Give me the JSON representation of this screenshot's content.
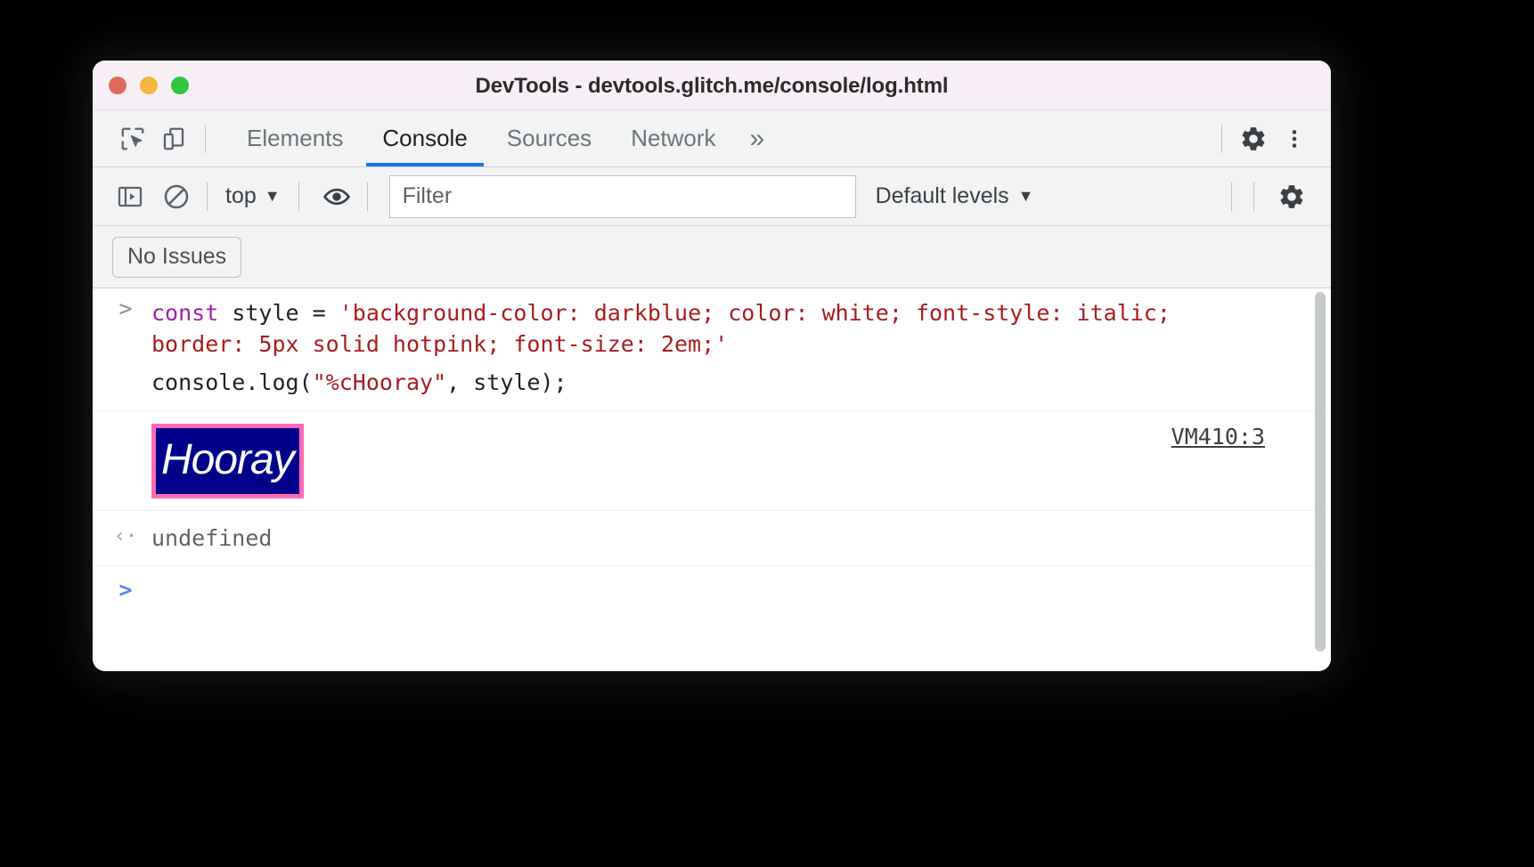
{
  "window": {
    "title": "DevTools - devtools.glitch.me/console/log.html",
    "traffic_lights": [
      {
        "name": "close",
        "color": "#e0695f"
      },
      {
        "name": "minimize",
        "color": "#f4b63f"
      },
      {
        "name": "maximize",
        "color": "#2ec840"
      }
    ]
  },
  "tabbar": {
    "left_icons": [
      {
        "name": "inspect-element-icon",
        "label": "Inspect element"
      },
      {
        "name": "device-toolbar-icon",
        "label": "Toggle device toolbar"
      }
    ],
    "tabs": [
      {
        "label": "Elements",
        "active": false
      },
      {
        "label": "Console",
        "active": true
      },
      {
        "label": "Sources",
        "active": false
      },
      {
        "label": "Network",
        "active": false
      }
    ],
    "more_tabs_label": "»",
    "right_icons": [
      {
        "name": "settings-gear-icon",
        "label": "Settings"
      },
      {
        "name": "more-options-icon",
        "label": "Customize and control DevTools"
      }
    ],
    "active_underline_color": "#1a73e8"
  },
  "filterbar": {
    "sidebar_toggle": "console-sidebar-icon",
    "clear_console": "clear-console-icon",
    "context_selector": {
      "value": "top",
      "caret": "▼"
    },
    "live_expression": "eye-icon",
    "filter": {
      "placeholder": "Filter",
      "value": ""
    },
    "levels_selector": {
      "value": "Default levels",
      "caret": "▼"
    },
    "settings_gear": "console-settings-gear-icon"
  },
  "issuesbar": {
    "no_issues_label": "No Issues"
  },
  "console": {
    "input_prompt": ">",
    "input_line": {
      "keyword": "const",
      "middle": " style = ",
      "string": "'background-color: darkblue; color: white; font-style: italic; border: 5px solid hotpink; font-size: 2em;'"
    },
    "log_line": {
      "before": "console.log(",
      "string": "\"%cHooray\"",
      "after": ", style);"
    },
    "output": {
      "text": "Hooray",
      "background_color": "#00008b",
      "text_color": "#ffffff",
      "border": "5px solid hotpink",
      "border_color": "#ff69b4",
      "font_style": "italic",
      "font_size": "2em",
      "source_link": "VM410:3"
    },
    "result": {
      "arrow": "‹·",
      "value": "undefined"
    },
    "new_prompt": ">"
  }
}
